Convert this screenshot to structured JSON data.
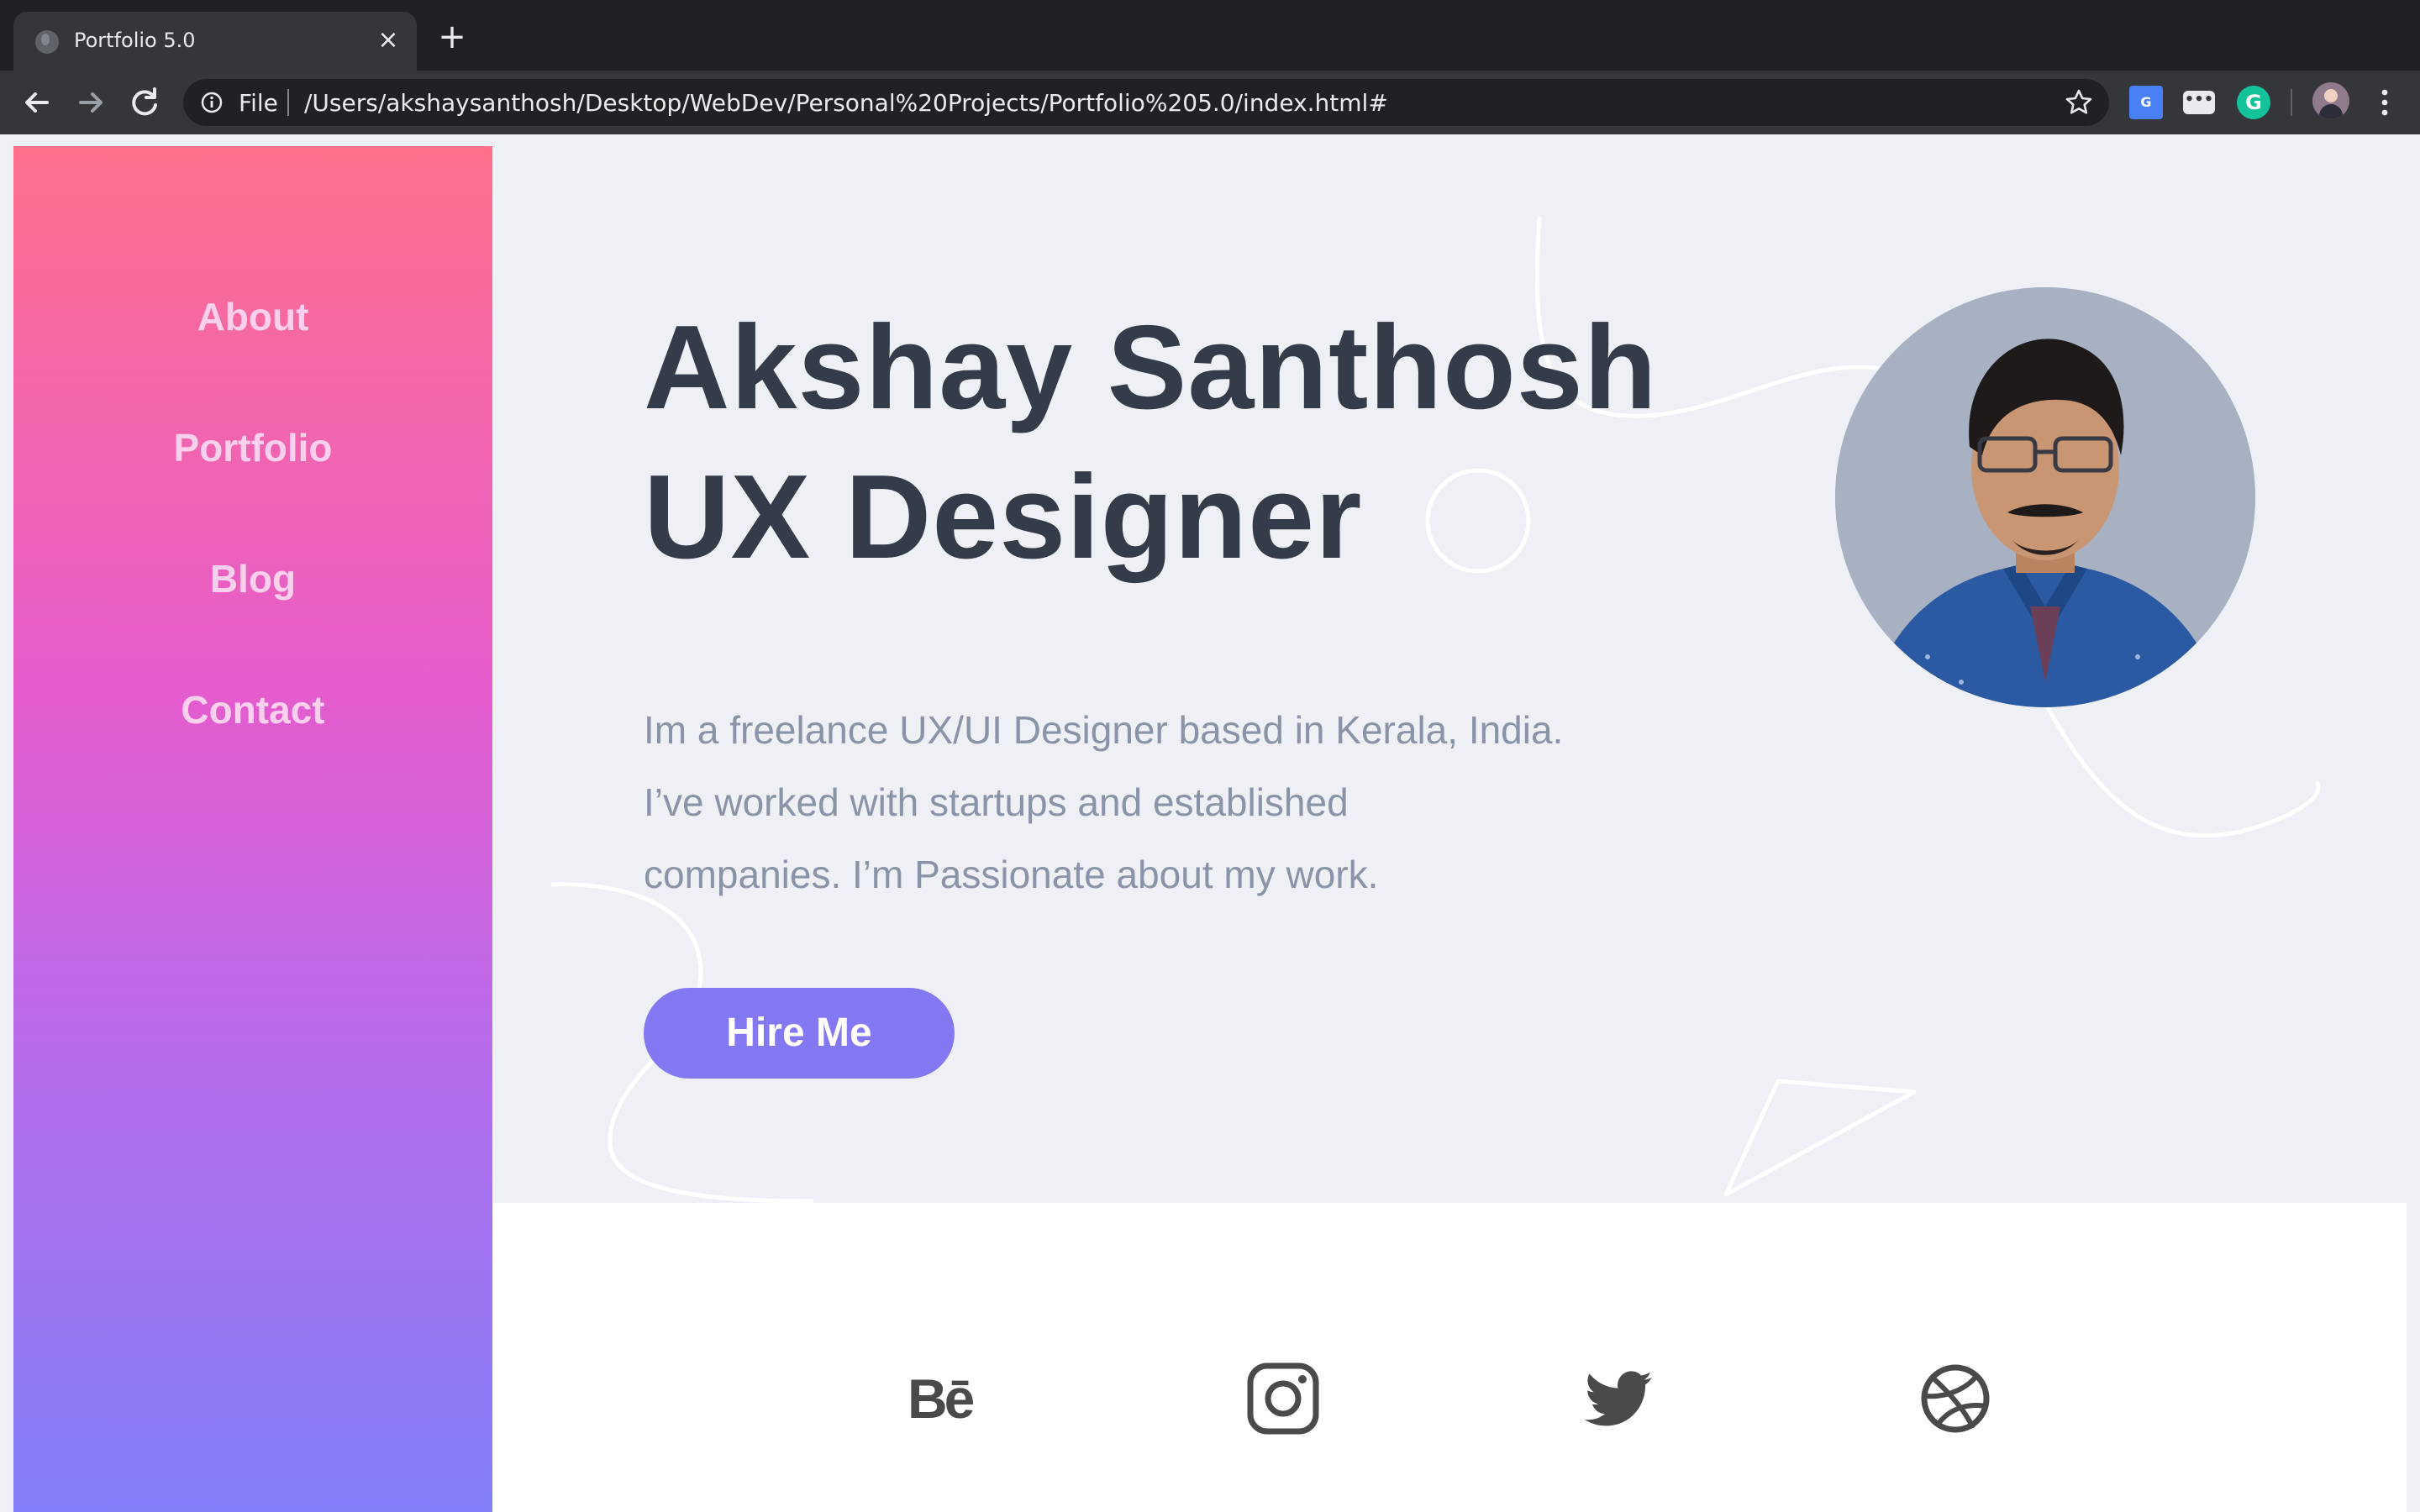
{
  "browser": {
    "tab_title": "Portfolio 5.0",
    "tab_close": "×",
    "new_tab": "+",
    "url_scheme": "File",
    "url": "/Users/akshaysanthosh/Desktop/WebDev/Personal%20Projects/Portfolio%205.0/index.html#",
    "extensions": {
      "translate": "G",
      "dots": "•••",
      "grammarly": "G"
    }
  },
  "sidebar": {
    "items": [
      {
        "label": "About"
      },
      {
        "label": "Portfolio"
      },
      {
        "label": "Blog"
      },
      {
        "label": "Contact"
      }
    ]
  },
  "hero": {
    "name": "Akshay Santhosh",
    "role": "UX Designer",
    "bio_lines": [
      "Im a freelance UX/UI Designer based in Kerala, India.",
      "I’ve worked with startups and established",
      "companies. I’m Passionate about my work."
    ],
    "cta_label": "Hire Me"
  },
  "social": {
    "behance_label": "Bē",
    "icons": [
      "behance-icon",
      "instagram-icon",
      "twitter-icon",
      "dribbble-icon"
    ]
  },
  "colors": {
    "sidebar_gradient_top": "#ff6f8b",
    "sidebar_gradient_bottom": "#7f7ef8",
    "cta": "#8378f2",
    "heading": "#333c48",
    "body_text": "#8a93a8",
    "page_bg": "#eff0f5"
  }
}
